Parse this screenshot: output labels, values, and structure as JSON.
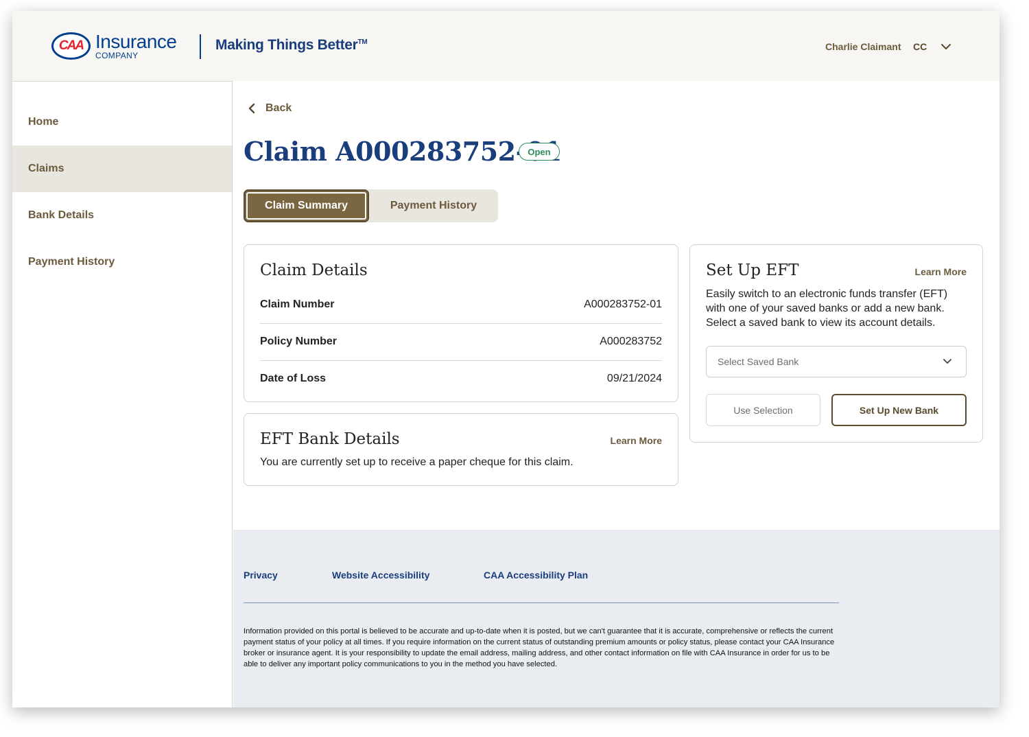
{
  "header": {
    "logo_badge": "CAA",
    "logo_name": "Insurance",
    "logo_company": "COMPANY",
    "tagline": "Making Things Better",
    "tagline_tm": "TM",
    "user_name": "Charlie Claimant",
    "user_initials": "CC",
    "user_menu_icon": "chevron-down-icon"
  },
  "sidebar": {
    "items": [
      {
        "label": "Home"
      },
      {
        "label": "Claims",
        "active": true
      },
      {
        "label": "Bank Details"
      },
      {
        "label": "Payment History"
      }
    ]
  },
  "main": {
    "back_label": "Back",
    "claim_title": "Claim A000283752-01",
    "status": "Open",
    "tabs": [
      {
        "label": "Claim Summary",
        "active": true
      },
      {
        "label": "Payment History",
        "active": false
      }
    ]
  },
  "claim_details": {
    "title": "Claim Details",
    "rows": [
      {
        "label": "Claim Number",
        "value": "A000283752-01"
      },
      {
        "label": "Policy Number",
        "value": "A000283752"
      },
      {
        "label": "Date of Loss",
        "value": "09/21/2024"
      }
    ]
  },
  "eft_bank": {
    "title": "EFT Bank Details",
    "learn_more": "Learn More",
    "text": "You are currently set up to receive a paper cheque for this claim."
  },
  "setup_eft": {
    "title": "Set Up EFT",
    "learn_more": "Learn More",
    "description": "Easily switch to an electronic funds transfer (EFT) with one of your saved banks or add a new bank. Select a saved bank to view its account details.",
    "select_placeholder": "Select Saved Bank",
    "use_selection": "Use Selection",
    "setup_new_bank": "Set Up New Bank"
  },
  "footer": {
    "links": [
      "Privacy",
      "Website Accessibility",
      "CAA Accessibility Plan"
    ],
    "disclaimer": "Information provided on this portal is believed to be accurate and up-to-date when it is posted, but we can't guarantee that it is accurate, comprehensive or reflects the current payment status of your policy at all times. If you require information on the current status of outstanding premium amounts or policy status, please contact your CAA Insurance broker or insurance agent. It is your responsibility to update the email address, mailing address, and other contact information on file with CAA Insurance in order for us to be able to deliver any important policy communications to you in the method you have selected."
  },
  "colors": {
    "brand_blue": "#1a3d7c",
    "brand_brown": "#7a6641",
    "status_green": "#2f8a5a",
    "caa_red": "#e4222d"
  }
}
